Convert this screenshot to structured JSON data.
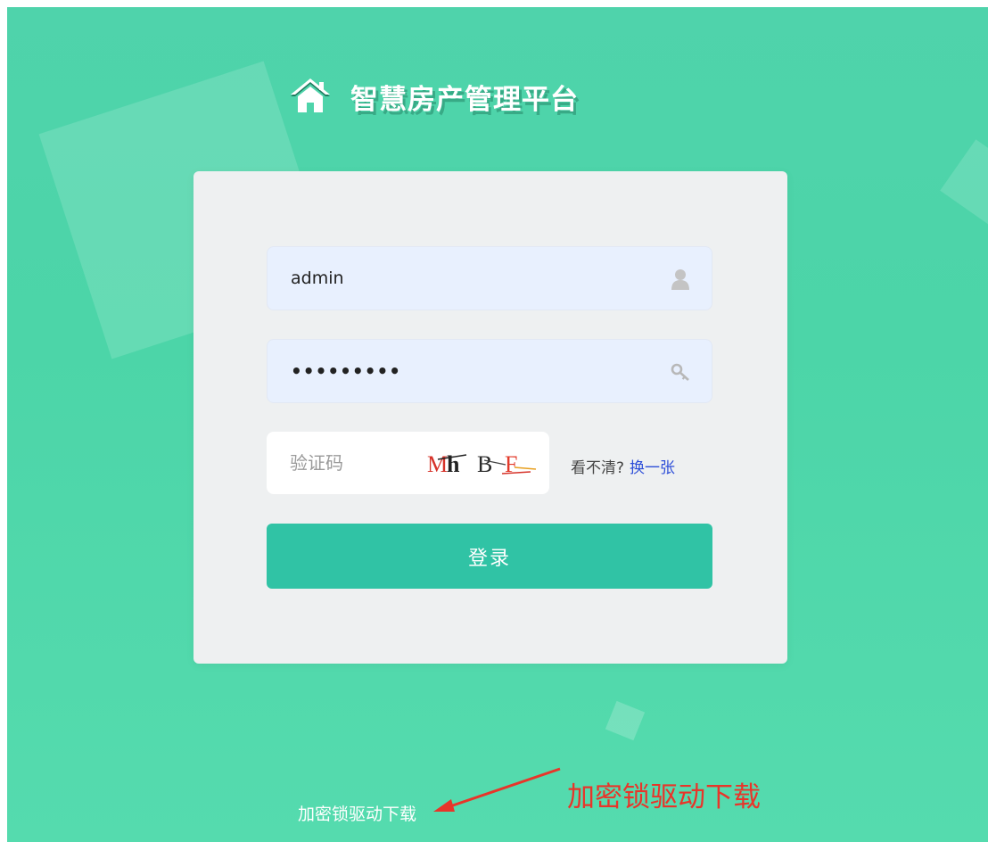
{
  "header": {
    "title": "智慧房产管理平台",
    "icon": "home-icon"
  },
  "login_form": {
    "username_value": "admin",
    "username_icon": "user-icon",
    "password_value": "•••••••••",
    "password_icon": "key-icon",
    "captcha_placeholder": "验证码",
    "captcha_image_text": "Mh B F",
    "captcha_hint": "看不清?",
    "captcha_refresh": "换一张",
    "login_label": "登录"
  },
  "footer": {
    "driver_download_link": "加密锁驱动下载"
  },
  "annotation": {
    "text": "加密锁驱动下载",
    "color": "#e8352a"
  },
  "colors": {
    "background": "#4fd3ab",
    "primary": "#30c3a5",
    "link": "#2d4ed8"
  }
}
